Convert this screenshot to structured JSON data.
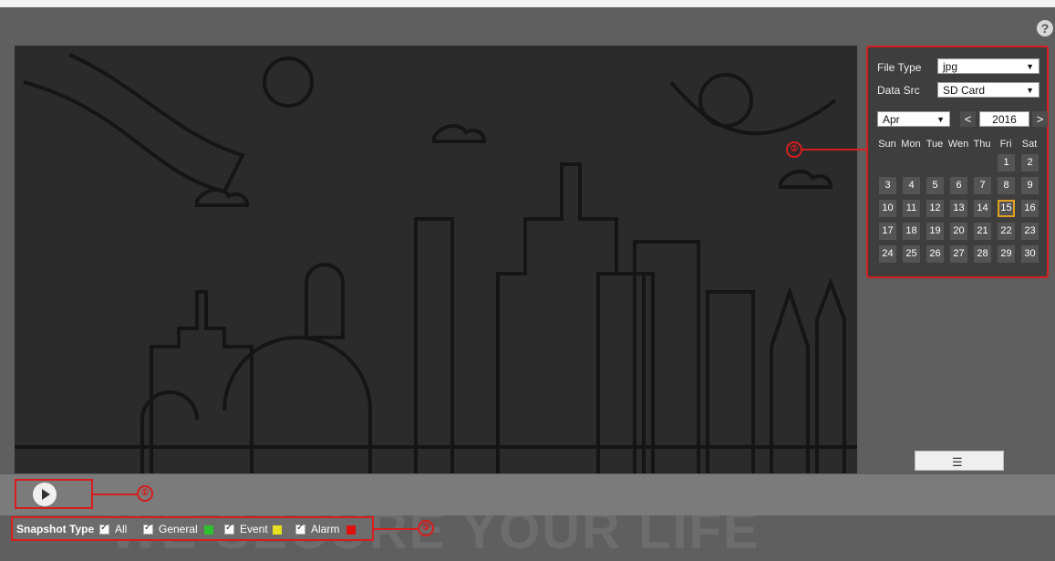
{
  "help_label": "?",
  "filters": {
    "file_type_label": "File Type",
    "file_type_value": "jpg",
    "data_src_label": "Data Src",
    "data_src_value": "SD Card"
  },
  "calendar": {
    "month": "Apr",
    "year": "2016",
    "prev_label": "<",
    "next_label": ">",
    "weekdays": [
      "Sun",
      "Mon",
      "Tue",
      "Wen",
      "Thu",
      "Fri",
      "Sat"
    ],
    "days": [
      "1",
      "2",
      "3",
      "4",
      "5",
      "6",
      "7",
      "8",
      "9",
      "10",
      "11",
      "12",
      "13",
      "14",
      "15",
      "16",
      "17",
      "18",
      "19",
      "20",
      "21",
      "22",
      "23",
      "24",
      "25",
      "26",
      "27",
      "28",
      "29",
      "30"
    ],
    "selected_day": "15"
  },
  "callouts": {
    "c1": "①",
    "c2": "②",
    "c3": "③"
  },
  "list_button_icon": "list-icon",
  "list_button_glyph": "☰",
  "snapshot": {
    "label": "Snapshot Type",
    "options": [
      {
        "label": "All",
        "checked": true
      },
      {
        "label": "General",
        "checked": true,
        "color": "#2fbf2f"
      },
      {
        "label": "Event",
        "checked": true,
        "color": "#e8e020"
      },
      {
        "label": "Alarm",
        "checked": true,
        "color": "#e01010"
      }
    ]
  },
  "watermark": "WE SECURE YOUR LIFE"
}
